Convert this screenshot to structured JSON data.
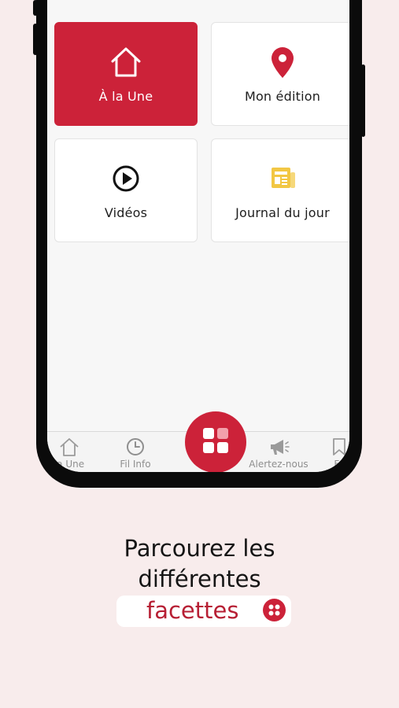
{
  "tiles": [
    {
      "label": "À la Une",
      "icon": "home-icon",
      "active": true
    },
    {
      "label": "Mon édition",
      "icon": "location-pin-icon",
      "active": false
    },
    {
      "label": "Vidéos",
      "icon": "play-circle-icon",
      "active": false
    },
    {
      "label": "Journal du jour",
      "icon": "newspaper-icon",
      "active": false
    }
  ],
  "tabbar": {
    "items": [
      {
        "label": "la Une",
        "icon": "home-icon"
      },
      {
        "label": "Fil Info",
        "icon": "clock-icon"
      },
      {
        "label": "Alertez-nous",
        "icon": "megaphone-icon"
      },
      {
        "label": "Fa",
        "icon": "bookmark-icon"
      }
    ],
    "center_icon": "grid-icon"
  },
  "caption": {
    "line1": "Parcourez les",
    "line2": "différentes",
    "highlight": "facettes",
    "badge_icon": "grid-icon"
  },
  "colors": {
    "accent": "#cc2239",
    "background": "#f8ecec",
    "journal_icon": "#f2c744"
  }
}
